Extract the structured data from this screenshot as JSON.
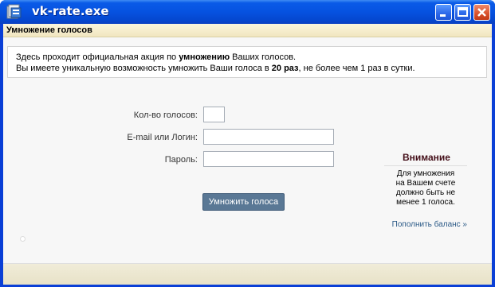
{
  "window": {
    "title": "vk-rate.exe"
  },
  "subheader": {
    "title": "Умножение голосов"
  },
  "notice": {
    "line1_pre": "Здесь проходит официальная акция по ",
    "line1_bold": "умножению",
    "line1_post": " Ваших голосов.",
    "line2_pre": "Вы имеете уникальную возможность умножить Ваши голоса в ",
    "line2_bold": "20 раз",
    "line2_post": ", не более чем 1 раз в сутки."
  },
  "form": {
    "votes_label": "Кол-во голосов:",
    "votes_value": "",
    "login_label": "E-mail или Логин:",
    "login_value": "",
    "password_label": "Пароль:",
    "password_value": "",
    "submit_label": "Умножить голоса"
  },
  "warning": {
    "title": "Внимание",
    "text_l1": "Для умножения",
    "text_l2": "на Вашем счете",
    "text_l3": "должно быть не",
    "text_l4": "менее 1 голоса.",
    "topup_link": "Пополнить баланс »"
  }
}
